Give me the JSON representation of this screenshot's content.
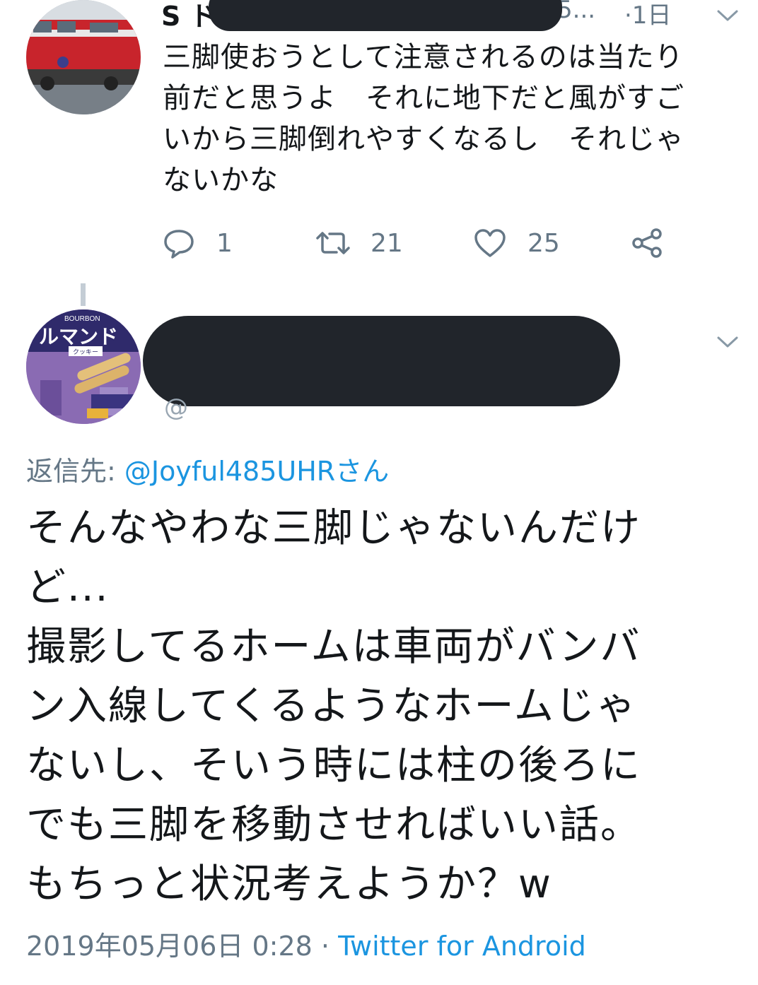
{
  "tweet1": {
    "name": "S ド",
    "handle": "5...",
    "time": "·1日",
    "text_lines": [
      "三脚使おうとして注意されるのは当たり",
      "前だと思うよ　それに地下だと風がすご",
      "いから三脚倒れやすくなるし　それじゃ",
      "ないかな"
    ],
    "actions": {
      "reply_count": "1",
      "retweet_count": "21",
      "like_count": "25"
    }
  },
  "tweet2": {
    "handle_peek": "@",
    "reply_label": "返信先:",
    "reply_handle": "@Joyful485UHRさん",
    "text_lines": [
      "そんなやわな三脚じゃないんだけ",
      "ど...",
      "撮影してるホームは車両がバンバ",
      "ン入線してくるようなホームじゃ",
      "ないし、そいう時には柱の後ろに",
      "でも三脚を移動させればいい話。",
      "もちっと状況考えようか？w"
    ],
    "timestamp": "2019年05月06日 0:28",
    "separator": " · ",
    "source": "Twitter for Android",
    "avatar_text": {
      "brand": "BOURBON",
      "product": "ルマンド",
      "sub": "クッキー"
    }
  },
  "colors": {
    "text": "#14171a",
    "secondary": "#657786",
    "link": "#1b95e0",
    "redaction": "#21252b"
  }
}
